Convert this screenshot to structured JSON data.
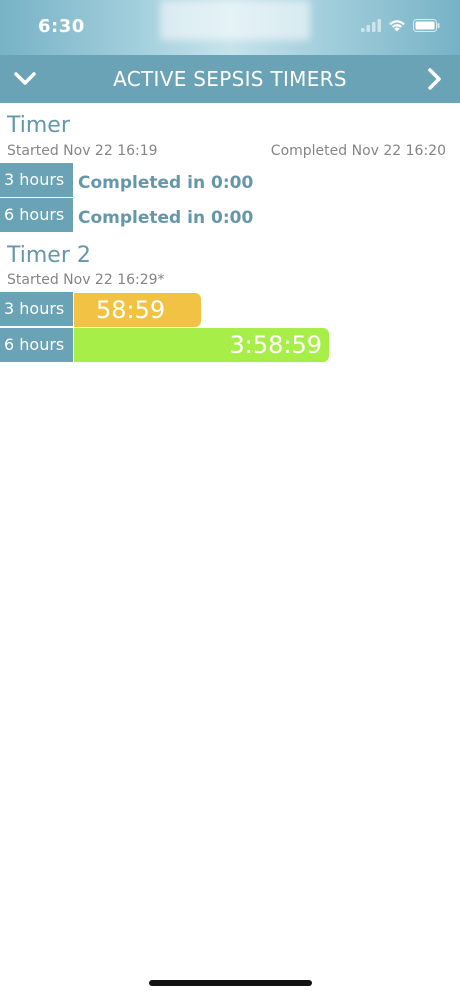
{
  "status_bar": {
    "time": "6:30",
    "icons": [
      "cellular-signal-icon",
      "wifi-icon",
      "battery-icon"
    ]
  },
  "nav": {
    "title": "ACTIVE SEPSIS TIMERS",
    "left_icon": "chevron-down-icon",
    "right_icon": "chevron-right-icon"
  },
  "timers": [
    {
      "name": "Timer",
      "started": "Started Nov 22 16:19",
      "completed": "Completed Nov 22 16:20",
      "rows": [
        {
          "label": "3 hours",
          "value": "Completed in 0:00"
        },
        {
          "label": "6 hours",
          "value": "Completed in 0:00"
        }
      ]
    },
    {
      "name": "Timer 2",
      "started": "Started Nov 22 16:29*",
      "rows": [
        {
          "label": "3 hours",
          "value": "58:59",
          "remaining_fraction": 0.33,
          "color": "#f1c244"
        },
        {
          "label": "6 hours",
          "value": "3:58:59",
          "remaining_fraction": 0.66,
          "color": "#a8ee48"
        }
      ]
    }
  ],
  "colors": {
    "accent": "#6aa3b6",
    "title_text": "#6597aa",
    "meta_text": "#858585",
    "countdown_3h": "#f1c244",
    "countdown_6h": "#a8ee48"
  }
}
